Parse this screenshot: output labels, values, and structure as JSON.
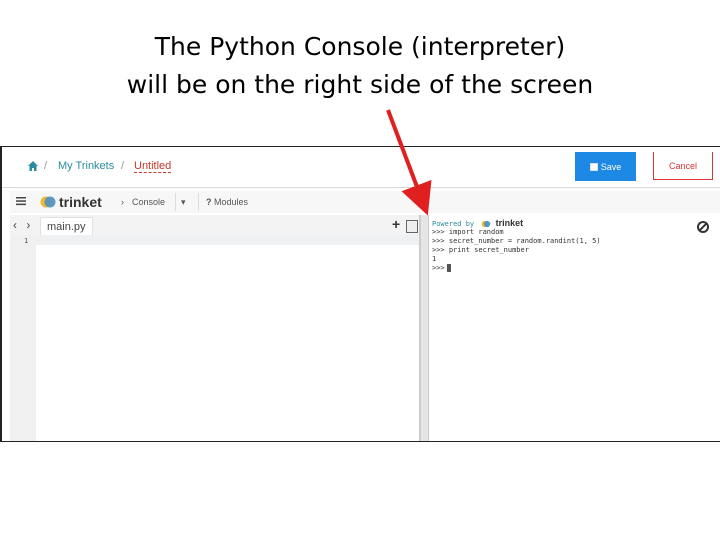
{
  "caption": {
    "line1": "The Python Console (interpreter)",
    "line2": "will be on the right side of the screen"
  },
  "breadcrumb": {
    "my_trinkets": "My Trinkets",
    "separator": "/",
    "untitled": "Untitled"
  },
  "actions": {
    "save_label": "Save",
    "cancel_label": "Cancel"
  },
  "toolbar": {
    "logo_text": "trinket",
    "console_label": "Console",
    "modules_label": "Modules",
    "chevron": "›",
    "caret": "▾",
    "question": "?"
  },
  "editor": {
    "file_tab": "main.py",
    "line_number": "1",
    "nav": "‹ ›",
    "add": "+"
  },
  "console": {
    "powered_by": "Powered by",
    "powered_logo": "trinket",
    "lines": [
      ">>> import random",
      ">>> secret_number = random.randint(1, 5)",
      ">>> print secret_number",
      "1",
      ">>>"
    ]
  },
  "colors": {
    "accent": "#1e88e5",
    "cancel": "#dd3333",
    "link": "#2a8c9e",
    "arrow": "#e02020"
  },
  "icons": [
    "home-icon",
    "menu-icon",
    "trinket-logo-icon",
    "image-icon",
    "stop-icon",
    "save-icon"
  ]
}
